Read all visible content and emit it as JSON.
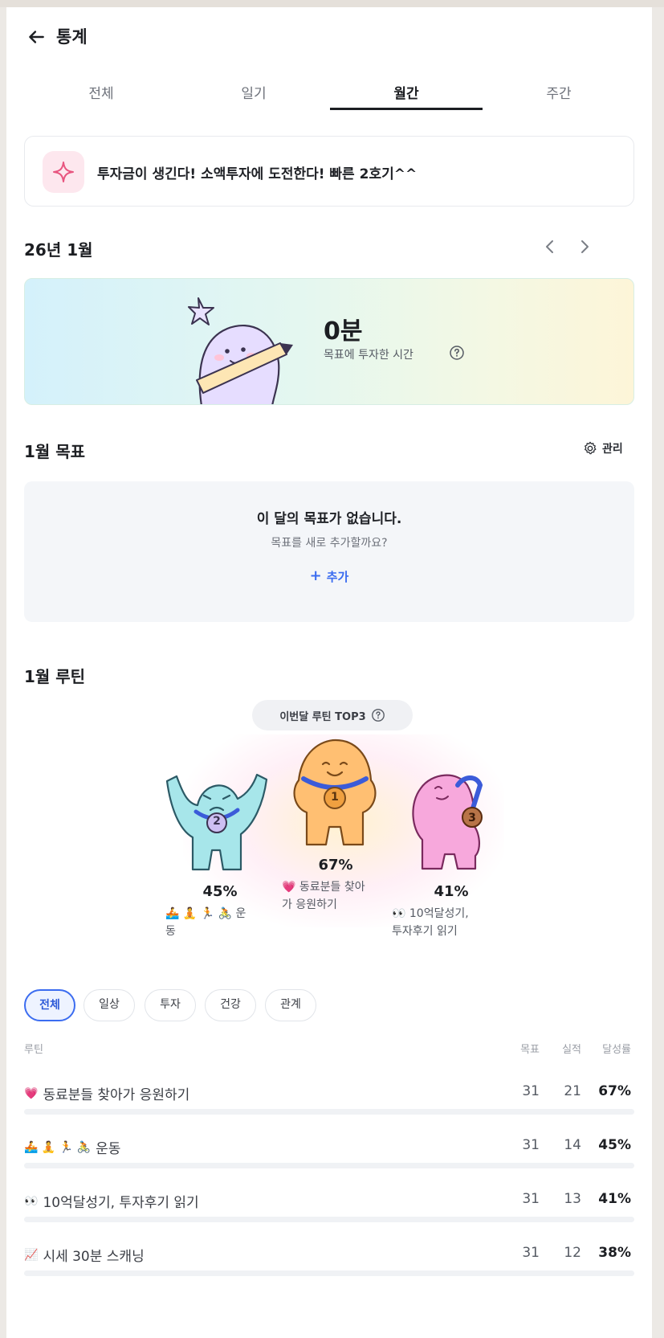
{
  "header": {
    "title": "통계"
  },
  "tabs": [
    {
      "label": "전체",
      "active": false
    },
    {
      "label": "일기",
      "active": false
    },
    {
      "label": "월간",
      "active": true
    },
    {
      "label": "주간",
      "active": false
    }
  ],
  "announcement": {
    "text": "투자금이 생긴다! 소액투자에 도전한다! 빠른 2호기^^",
    "icon": "sparkle-icon"
  },
  "month_nav": {
    "label": "26년 1월"
  },
  "time_card": {
    "value": "0분",
    "caption": "목표에 투자한 시간"
  },
  "goals": {
    "title": "1월 목표",
    "manage_label": "관리",
    "empty_title": "이 달의 목표가 없습니다.",
    "empty_subtitle": "목표를 새로 추가할까요?",
    "add_label": "추가"
  },
  "routine": {
    "title": "1월 루틴",
    "top3_label": "이번달 루틴 TOP3",
    "podium": [
      {
        "rank": "2",
        "percent": "45%",
        "name_line1": "🚣 🧘 🏃 🚴 운",
        "name_line2": "동"
      },
      {
        "rank": "1",
        "percent": "67%",
        "name_line1": "💗 동료분들 찾아",
        "name_line2": "가 응원하기"
      },
      {
        "rank": "3",
        "percent": "41%",
        "name_line1": "👀 10억달성기,",
        "name_line2": "투자후기 읽기"
      }
    ]
  },
  "filters": [
    "전체",
    "일상",
    "투자",
    "건강",
    "관계"
  ],
  "table": {
    "headers": {
      "name": "루틴",
      "goal": "목표",
      "actual": "실적",
      "rate": "달성률"
    },
    "rows": [
      {
        "icon": "💗",
        "name": "동료분들 찾아가 응원하기",
        "goal": "31",
        "actual": "21",
        "rate": "67%"
      },
      {
        "icon": "🚣 🧘 🏃 🚴",
        "name": "운동",
        "goal": "31",
        "actual": "14",
        "rate": "45%"
      },
      {
        "icon": "👀",
        "name": "10억달성기, 투자후기 읽기",
        "goal": "31",
        "actual": "13",
        "rate": "41%"
      },
      {
        "icon": "📈",
        "name": "시세 30분 스캐닝",
        "goal": "31",
        "actual": "12",
        "rate": "38%"
      }
    ]
  },
  "colors": {
    "accent": "#3b6cf0",
    "text": "#1c1e22",
    "muted": "#6d717a"
  }
}
